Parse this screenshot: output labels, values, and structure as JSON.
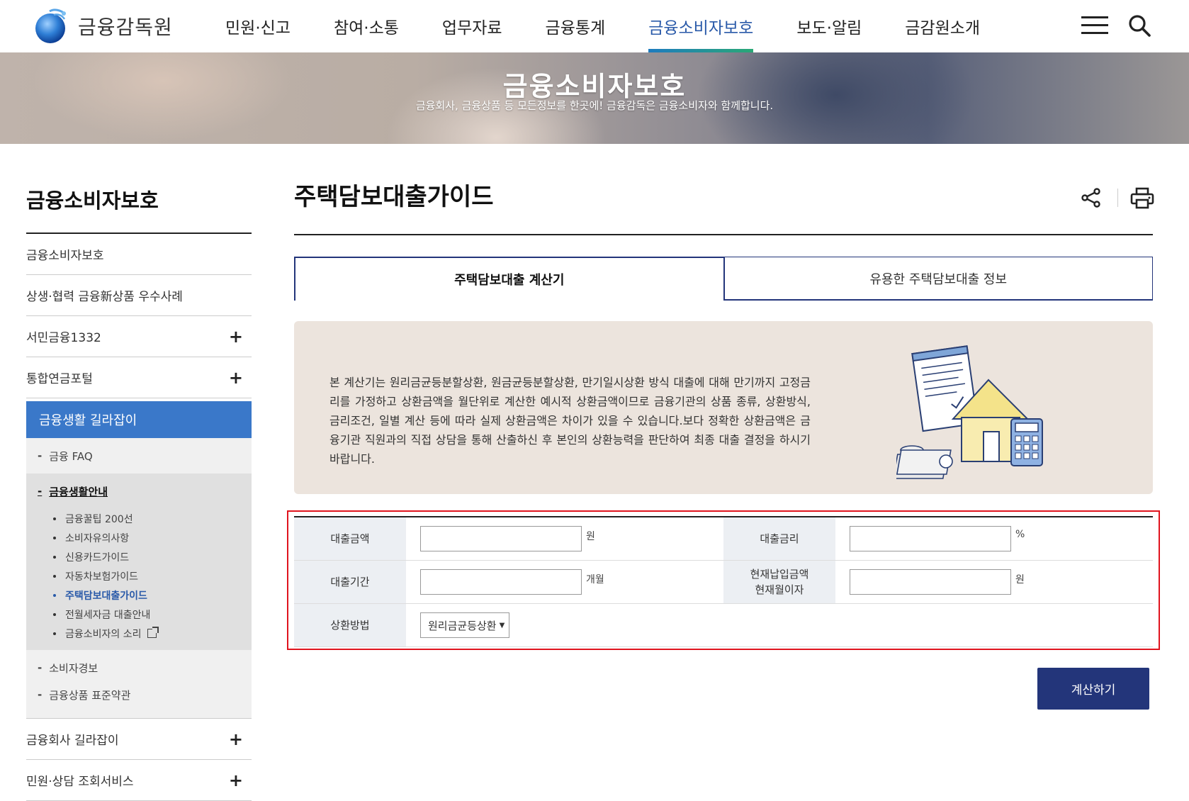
{
  "header": {
    "logo_text": "금융감독원",
    "menu": [
      {
        "label": "민원·신고"
      },
      {
        "label": "참여·소통"
      },
      {
        "label": "업무자료"
      },
      {
        "label": "금융통계"
      },
      {
        "label": "금융소비자보호"
      },
      {
        "label": "보도·알림"
      },
      {
        "label": "금감원소개"
      }
    ]
  },
  "banner": {
    "title": "금융소비자보호",
    "subtitle": "금융회사, 금융상품 등 모든정보를 한곳에! 금융감독은 금융소비자와 함께합니다."
  },
  "sidebar": {
    "title": "금융소비자보호",
    "items": [
      {
        "label": "금융소비자보호"
      },
      {
        "label": "상생·협력 금융新상품 우수사례"
      },
      {
        "label": "서민금융1332",
        "expand": "+"
      },
      {
        "label": "통합연금포털",
        "expand": "+"
      }
    ],
    "active": "금융생활 길라잡이",
    "sub": {
      "faq": "금융 FAQ",
      "guide": "금융생활안내",
      "guide_items": [
        "금융꿀팁 200선",
        "소비자유의사항",
        "신용카드가이드",
        "자동차보험가이드",
        "주택담보대출가이드",
        "전월세자금 대출안내",
        "금융소비자의 소리"
      ],
      "alert": "소비자경보",
      "terms": "금융상품 표준약관"
    },
    "bottom_items": [
      {
        "label": "금융회사 길라잡이",
        "expand": "+"
      },
      {
        "label": "민원·상담 조회서비스",
        "expand": "+"
      }
    ]
  },
  "main": {
    "page_title": "주택담보대출가이드",
    "tabs": [
      {
        "label": "주택담보대출 계산기",
        "active": true
      },
      {
        "label": "유용한 주택담보대출 정보",
        "active": false
      }
    ],
    "info": "본 계산기는 원리금균등분할상환, 원금균등분할상환, 만기일시상환 방식 대출에 대해 만기까지 고정금리를 가정하고 상환금액을 월단위로 계산한 예시적 상환금액이므로 금융기관의 상품 종류, 상환방식, 금리조건, 일별 계산 등에 따라 실제 상환금액은 차이가 있을 수 있습니다.보다 정확한 상환금액은 금융기관 직원과의 직접 상담을 통해 산출하신 후 본인의 상환능력을 판단하여 최종 대출 결정을 하시기 바랍니다.",
    "form": {
      "loan_amount": {
        "label": "대출금액",
        "value": "",
        "unit": "원"
      },
      "interest_rate": {
        "label": "대출금리",
        "value": "",
        "unit": "%"
      },
      "loan_period": {
        "label": "대출기간",
        "value": "",
        "unit": "개월"
      },
      "paid_amount": {
        "label_line1": "현재납입금액",
        "label_line2": "현재월이자",
        "value": "",
        "unit": "원"
      },
      "repayment": {
        "label": "상환방법",
        "selected": "원리금균등상환"
      }
    },
    "calc_button": "계산하기"
  },
  "colors": {
    "accent": "#2a5aa9",
    "navy": "#23357a",
    "sidebar_active": "#3a78c9",
    "highlight_frame": "#e0141e"
  }
}
